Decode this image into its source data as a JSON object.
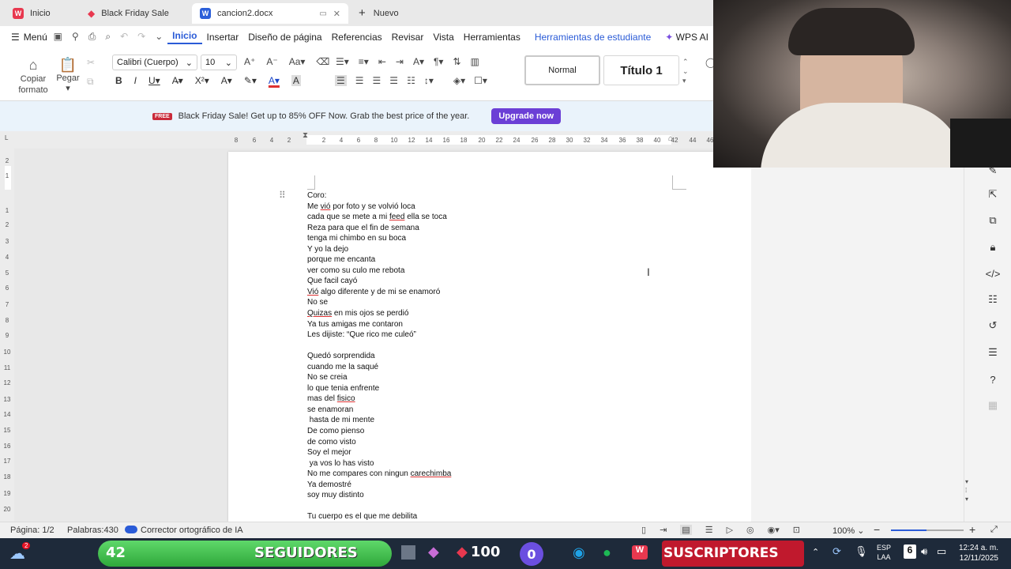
{
  "tabs": [
    {
      "label": "Inicio"
    },
    {
      "label": "Black Friday Sale"
    },
    {
      "label": "cancion2.docx"
    }
  ],
  "new_tab_label": "Nuevo",
  "menu": {
    "menu_label": "Menú",
    "items": [
      "Inicio",
      "Insertar",
      "Diseño de página",
      "Referencias",
      "Revisar",
      "Vista",
      "Herramientas",
      "Herramientas de estudiante",
      "WPS AI"
    ]
  },
  "ribbon": {
    "copy_format": "Copiar formato",
    "paste": "Pegar",
    "font": "Calibri (Cuerpo)",
    "size": "10",
    "style_normal": "Normal",
    "style_title": "Título 1"
  },
  "banner": {
    "text": "Black Friday Sale! Get up to 85% OFF Now. Grab the best price of the year.",
    "button": "Upgrade now"
  },
  "ruler_h": [
    "8",
    "6",
    "4",
    "2",
    "2",
    "4",
    "6",
    "8",
    "10",
    "12",
    "14",
    "16",
    "18",
    "20",
    "22",
    "24",
    "26",
    "28",
    "30",
    "32",
    "34",
    "36",
    "38",
    "40",
    "42",
    "44",
    "46"
  ],
  "ruler_v": [
    "2",
    "1",
    "1",
    "2",
    "3",
    "4",
    "5",
    "6",
    "7",
    "8",
    "9",
    "10",
    "11",
    "12",
    "13",
    "14",
    "15",
    "16",
    "17",
    "18",
    "19",
    "20"
  ],
  "document": {
    "lines": [
      "Coro:",
      "Me vió por foto y se volvió loca",
      "cada que se mete a mi feed ella se toca",
      "Reza para que el fin de semana",
      "tenga mi chimbo en su boca",
      "Y yo la dejo",
      "porque me encanta",
      "ver como su culo me rebota",
      "Que facil cayó",
      "Vió algo diferente y de mi se enamoró",
      "No se",
      "Quizas en mis ojos se perdió",
      "Ya tus amigas me contaron",
      "Les dijiste: “Que rico me culeó”",
      "",
      "Quedó sorprendida",
      "cuando me la saqué",
      "No se creia",
      "lo que tenia enfrente",
      "mas del fisico",
      "se enamoran",
      " hasta de mi mente",
      "De como pienso",
      "de como visto",
      "Soy el mejor",
      " ya vos lo has visto",
      "No me compares con ningun carechimba",
      "Ya demostré",
      "soy muy distinto",
      "",
      "Tu cuerpo es el que me debilita"
    ]
  },
  "status": {
    "page": "Página: 1/2",
    "words": "Palabras:430",
    "spell": "Corrector ortográfico de IA",
    "zoom": "100%"
  },
  "taskbar": {
    "followers_count": "42",
    "followers_label": "SEGUIDORES",
    "count_100": "100",
    "count_0": "0",
    "subscribers_label": "SUSCRIPTORES",
    "lang_top": "ESP",
    "lang_bottom": "LAA",
    "time": "12:24 a. m.",
    "date": "12/11/2025",
    "badge": "2",
    "num6": "6"
  }
}
